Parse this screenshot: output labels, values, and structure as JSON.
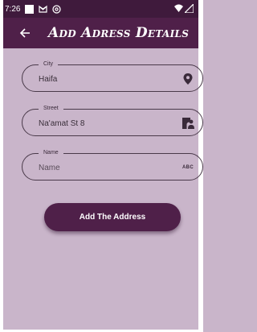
{
  "status_bar": {
    "time": "7:26",
    "icons": [
      "square-icon",
      "mail-icon",
      "at-icon",
      "wifi-icon",
      "signal-icon"
    ]
  },
  "app_bar": {
    "back_icon": "arrow-left-icon",
    "title": "Add Adress Details"
  },
  "form": {
    "city": {
      "label": "City",
      "value": "Haifa",
      "icon": "location-pin-icon"
    },
    "street": {
      "label": "Street",
      "value": "Na'amat St 8",
      "icon": "person-pin-icon"
    },
    "name": {
      "label": "Name",
      "placeholder": "Name",
      "icon": "abc-icon",
      "icon_text": "ABC"
    }
  },
  "submit_label": "Add The Address",
  "colors": {
    "primary": "#4f2049",
    "status_bar": "#3f1a3c",
    "background": "#c9b5ca"
  }
}
